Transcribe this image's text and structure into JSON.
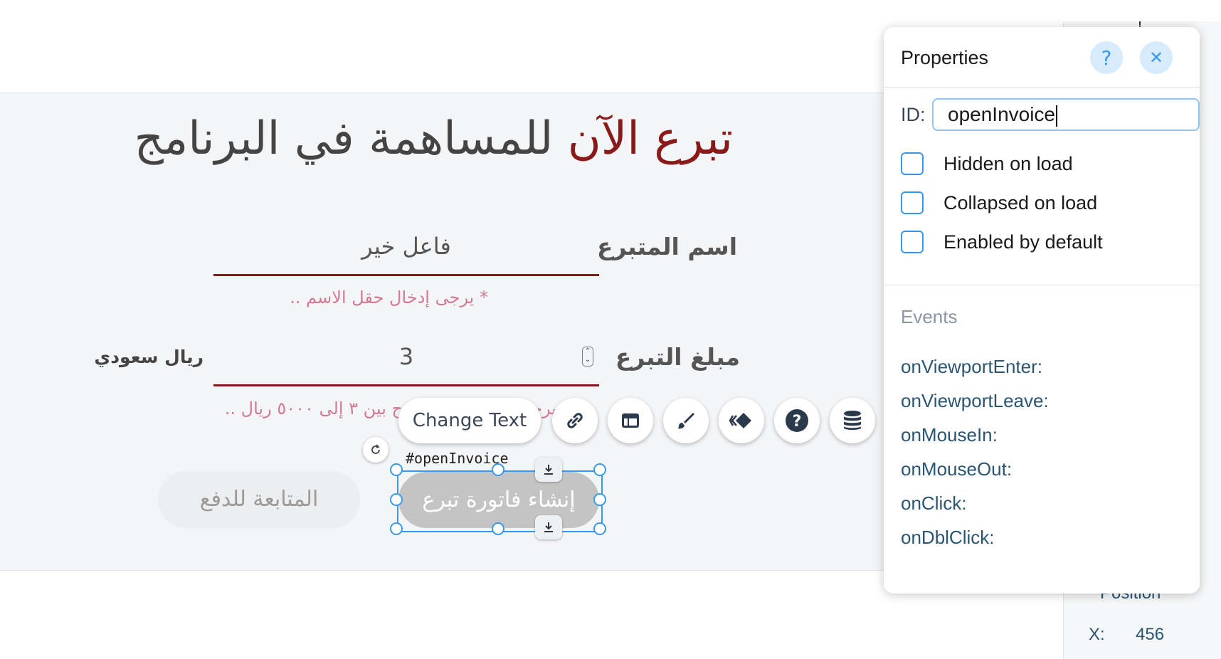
{
  "page": {
    "title_highlight": "تبرع الآن",
    "title_rest": " للمساهمة في البرنامج",
    "donor_name_label": "اسم المتبرع",
    "donor_name_value": "فاعل خير",
    "donor_name_error": "* يرجى إدخال حقل الاسم ..",
    "amount_label": "مبلغ التبرع",
    "amount_value": "3",
    "currency_label": "ريال سعودي",
    "amount_error_left": "ح بين ٣ إلى ٥٠٠٠ ريال ..",
    "amount_error_hidden_fragment": "يرجى",
    "invoice_button_label": "إنشاء فاتورة تبرع",
    "pay_button_label": "المتابعة للدفع"
  },
  "editor": {
    "change_text_label": "Change Text",
    "selected_element_tag": "#openInvoice",
    "toolbar_icons": [
      "link-icon",
      "layout-icon",
      "design-brush-icon",
      "animation-icon",
      "help-icon",
      "database-icon"
    ],
    "accent_color": "#3899ec"
  },
  "properties": {
    "title": "Properties",
    "help_glyph": "?",
    "close_glyph": "✕",
    "id_label": "ID:",
    "id_value": "openInvoice",
    "options": [
      {
        "label": "Hidden on load",
        "checked": false
      },
      {
        "label": "Collapsed on load",
        "checked": false
      },
      {
        "label": "Enabled by default",
        "checked": false
      }
    ],
    "events_title": "Events",
    "events": [
      "onViewportEnter:",
      "onViewportLeave:",
      "onMouseIn:",
      "onMouseOut:",
      "onClick:",
      "onDblClick:"
    ]
  },
  "side_panel": {
    "position_label": "Position",
    "x_label": "X:",
    "x_value": "456"
  }
}
